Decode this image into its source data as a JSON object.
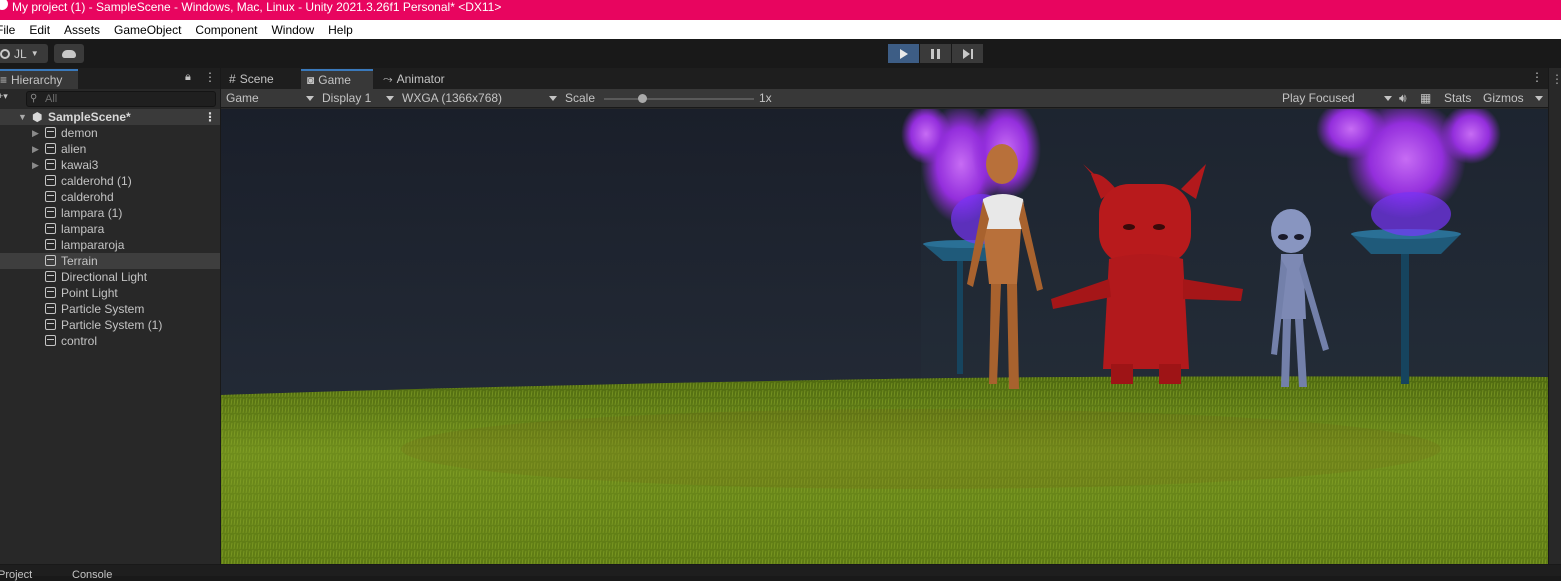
{
  "window": {
    "title": "My project (1) - SampleScene - Windows, Mac, Linux - Unity 2021.3.26f1 Personal* <DX11>"
  },
  "menu": [
    "File",
    "Edit",
    "Assets",
    "GameObject",
    "Component",
    "Window",
    "Help"
  ],
  "toolbar": {
    "account": "JL"
  },
  "hierarchy": {
    "tab": "Hierarchy",
    "search_placeholder": "All",
    "scene": "SampleScene*",
    "items": [
      {
        "label": "demon",
        "expandable": true
      },
      {
        "label": "alien",
        "expandable": true
      },
      {
        "label": "kawai3",
        "expandable": true
      },
      {
        "label": "calderohd (1)",
        "expandable": false
      },
      {
        "label": "calderohd",
        "expandable": false
      },
      {
        "label": "lampara (1)",
        "expandable": false
      },
      {
        "label": "lampara",
        "expandable": false
      },
      {
        "label": "lampararoja",
        "expandable": false
      },
      {
        "label": "Terrain",
        "expandable": false,
        "selected": true
      },
      {
        "label": "Directional Light",
        "expandable": false
      },
      {
        "label": "Point Light",
        "expandable": false
      },
      {
        "label": "Particle System",
        "expandable": false
      },
      {
        "label": "Particle System (1)",
        "expandable": false
      },
      {
        "label": "control",
        "expandable": false
      }
    ]
  },
  "game": {
    "tabs": [
      "Scene",
      "Game",
      "Animator"
    ],
    "active_tab": "Game",
    "view_select": "Game",
    "display": "Display 1",
    "resolution": "WXGA (1366x768)",
    "scale_label": "Scale",
    "scale_value": "1x",
    "scale_fraction": 0.25,
    "play_mode": "Play Focused",
    "stats": "Stats",
    "gizmos": "Gizmos"
  },
  "bottom_tabs": [
    "Project",
    "Console"
  ],
  "colors": {
    "title_bar": "#e8055f",
    "play_active": "#3d5d85",
    "sky": "#1d2330",
    "grass": "#6b8a1a",
    "demon": "#b2191c",
    "alien": "#8895c0",
    "fire": "#b040ff",
    "lamp": "#1f5a7a",
    "figure_skin": "#b8703a"
  }
}
